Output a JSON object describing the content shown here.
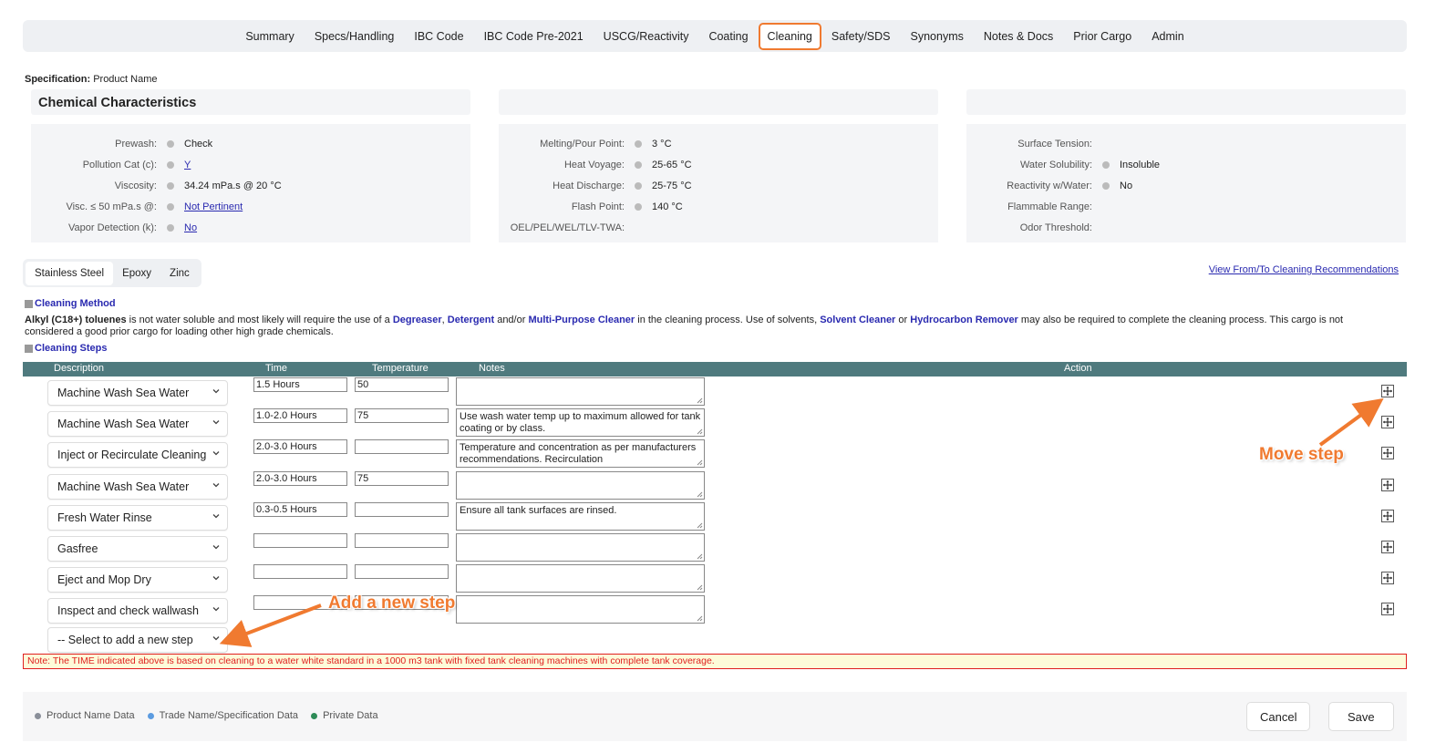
{
  "nav": {
    "tabs": [
      "Summary",
      "Specs/Handling",
      "IBC Code",
      "IBC Code Pre-2021",
      "USCG/Reactivity",
      "Coating",
      "Cleaning",
      "Safety/SDS",
      "Synonyms",
      "Notes & Docs",
      "Prior Cargo",
      "Admin"
    ],
    "active": "Cleaning"
  },
  "spec": {
    "label": "Specification:",
    "value": "Product Name"
  },
  "characteristics": {
    "title": "Chemical Characteristics",
    "col1": [
      {
        "label": "Prewash:",
        "value": "Check",
        "link": false
      },
      {
        "label": "Pollution Cat (c):",
        "value": "Y",
        "link": true
      },
      {
        "label": "Viscosity:",
        "value": "34.24 mPa.s @ 20 °C",
        "link": false
      },
      {
        "label": "Visc. ≤ 50 mPa.s @:",
        "value": "Not Pertinent",
        "link": true
      },
      {
        "label": "Vapor Detection (k):",
        "value": "No",
        "link": true
      }
    ],
    "col2": [
      {
        "label": "Melting/Pour Point:",
        "value": "3 °C"
      },
      {
        "label": "Heat Voyage:",
        "value": "25-65 °C"
      },
      {
        "label": "Heat Discharge:",
        "value": "25-75 °C"
      },
      {
        "label": "Flash Point:",
        "value": "140 °C"
      },
      {
        "label": "OEL/PEL/WEL/TLV-TWA:",
        "value": ""
      }
    ],
    "col3": [
      {
        "label": "Surface Tension:",
        "value": ""
      },
      {
        "label": "Water Solubility:",
        "value": "Insoluble"
      },
      {
        "label": "Reactivity w/Water:",
        "value": "No"
      },
      {
        "label": "Flammable Range:",
        "value": ""
      },
      {
        "label": "Odor Threshold:",
        "value": ""
      }
    ]
  },
  "material_tabs": [
    "Stainless Steel",
    "Epoxy",
    "Zinc"
  ],
  "view_link": "View From/To Cleaning Recommendations",
  "cleaning_method": {
    "title": "Cleaning Method",
    "cargo": "Alkyl (C18+) toluenes",
    "t1": " is not water soluble and most likely will require the use of a ",
    "k1": "Degreaser",
    "t2": ", ",
    "k2": "Detergent",
    "t3": " and/or ",
    "k3": "Multi-Purpose Cleaner",
    "t4": " in the cleaning process. Use of solvents, ",
    "k4": "Solvent Cleaner",
    "t5": " or ",
    "k5": "Hydrocarbon Remover",
    "t6": " may also be required to complete the cleaning process. This cargo is not considered a good prior cargo for loading other high grade chemicals."
  },
  "steps": {
    "title": "Cleaning Steps",
    "headers": {
      "description": "Description",
      "time": "Time",
      "temperature": "Temperature",
      "notes": "Notes",
      "action": "Action"
    },
    "rows": [
      {
        "description": "Machine Wash Sea Water",
        "time": "1.5 Hours",
        "temp": "50",
        "notes": ""
      },
      {
        "description": "Machine Wash Sea Water",
        "time": "1.0-2.0 Hours",
        "temp": "75",
        "notes": "Use wash water temp up to maximum allowed for tank coating or by class."
      },
      {
        "description": "Inject or Recirculate Cleaning",
        "time": "2.0-3.0 Hours",
        "temp": "",
        "notes": "Temperature and concentration as per manufacturers recommendations.  Recirculation"
      },
      {
        "description": "Machine Wash Sea Water",
        "time": "2.0-3.0 Hours",
        "temp": "75",
        "notes": ""
      },
      {
        "description": "Fresh Water Rinse",
        "time": "0.3-0.5 Hours",
        "temp": "",
        "notes": "Ensure all tank surfaces are rinsed."
      },
      {
        "description": "Gasfree",
        "time": "",
        "temp": "",
        "notes": ""
      },
      {
        "description": "Eject and Mop Dry",
        "time": "",
        "temp": "",
        "notes": ""
      },
      {
        "description": "Inspect and check wallwash",
        "time": "",
        "temp": "",
        "notes": ""
      }
    ],
    "new_step_placeholder": "-- Select to add a new step"
  },
  "note": "Note: The TIME indicated above is based on cleaning to a water white standard in a 1000 m3 tank with fixed tank cleaning machines with complete tank coverage.",
  "legend": [
    {
      "label": "Product Name Data",
      "color": "#8a8f99"
    },
    {
      "label": "Trade Name/Specification Data",
      "color": "#5b9be0"
    },
    {
      "label": "Private Data",
      "color": "#2e8b57"
    }
  ],
  "buttons": {
    "cancel": "Cancel",
    "save": "Save"
  },
  "annotations": {
    "move_step": "Move step",
    "add_step": "Add a new step"
  },
  "colors": {
    "accent": "#f07a30",
    "header_bar": "#4f7a7e",
    "link": "#2a2ab0",
    "note_red": "#e02020"
  }
}
